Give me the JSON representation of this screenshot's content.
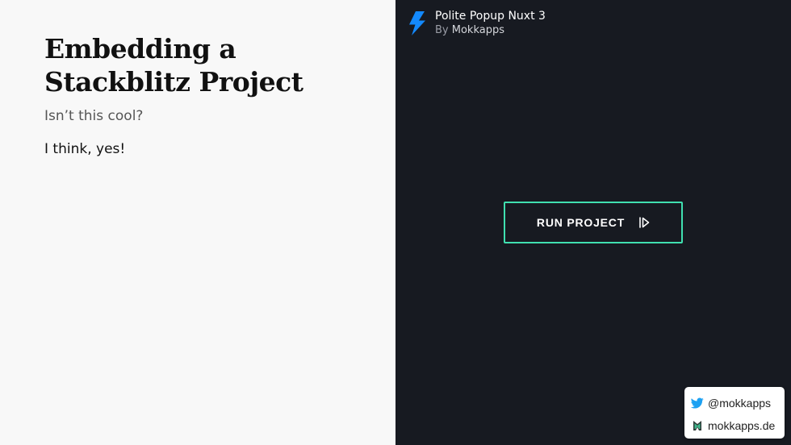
{
  "slide": {
    "title_line1": "Embedding a",
    "title_line2": "Stackblitz Project",
    "subtitle": "Isn’t this cool?",
    "body": "I think, yes!"
  },
  "embed": {
    "project_title": "Polite Popup Nuxt 3",
    "byline_prefix": "By",
    "author": "Mokkapps",
    "run_button_label": "RUN PROJECT",
    "logo_icon": "lightning-bolt-icon",
    "run_icon": "play-icon"
  },
  "social": {
    "twitter_handle": "@mokkapps",
    "website": "mokkapps.de",
    "twitter_icon": "twitter-bird-icon",
    "website_icon": "mokkapps-logo-icon"
  },
  "colors": {
    "embed_background": "#171a21",
    "accent_border": "#40e0b0",
    "bolt_blue": "#1389fd",
    "twitter_blue": "#1da1f2",
    "slide_background": "#f8f8f8"
  }
}
